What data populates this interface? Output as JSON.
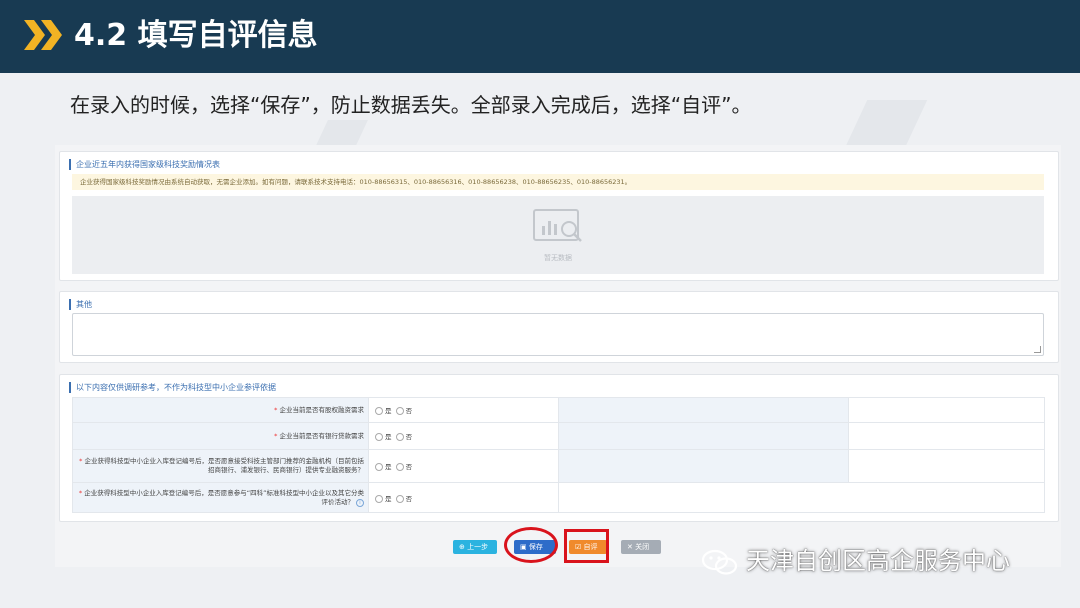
{
  "slide": {
    "title": "4.2 填写自评信息",
    "instruction": "在录入的时候，选择“保存”，防止数据丢失。全部录入完成后，选择“自评”。"
  },
  "awards_section": {
    "title": "企业近五年内获得国家级科技奖励情况表",
    "notice": "企业获得国家级科技奖励情况由系统自动获取，无需企业添加。如有问题，请联系技术支持电话：010-88656315、010-88656316、010-88656238、010-88656235、010-88656231。",
    "empty_text": "暂无数据"
  },
  "other_section": {
    "title": "其他"
  },
  "survey_section": {
    "title": "以下内容仅供调研参考，不作为科技型中小企业参评依据",
    "yes_label": "是",
    "no_label": "否",
    "questions": [
      "企业当前是否有股权融资需求",
      "企业当前是否有银行贷款需求",
      "企业获得科技型中小企业入库登记编号后，是否愿意接受科技主管部门推荐的金融机构（目前包括招商银行、浦发银行、民商银行）提供专业融资服务？",
      "企业获得科技型中小企业入库登记编号后，是否愿意参与“四科”标准科技型中小企业以及其它分类评价活动？"
    ]
  },
  "buttons": {
    "prev": "上一步",
    "save": "保存",
    "self_eval": "自评",
    "close": "关闭"
  },
  "watermark": "天津自创区高企服务中心",
  "colors": {
    "banner": "#183a52",
    "accent_chevron": "#f2b324",
    "highlight": "#d9131c"
  },
  "icons": {
    "title_marker": "double-chevron-icon",
    "empty": "empty-data-icon",
    "watermark_logo": "wechat-icon"
  }
}
